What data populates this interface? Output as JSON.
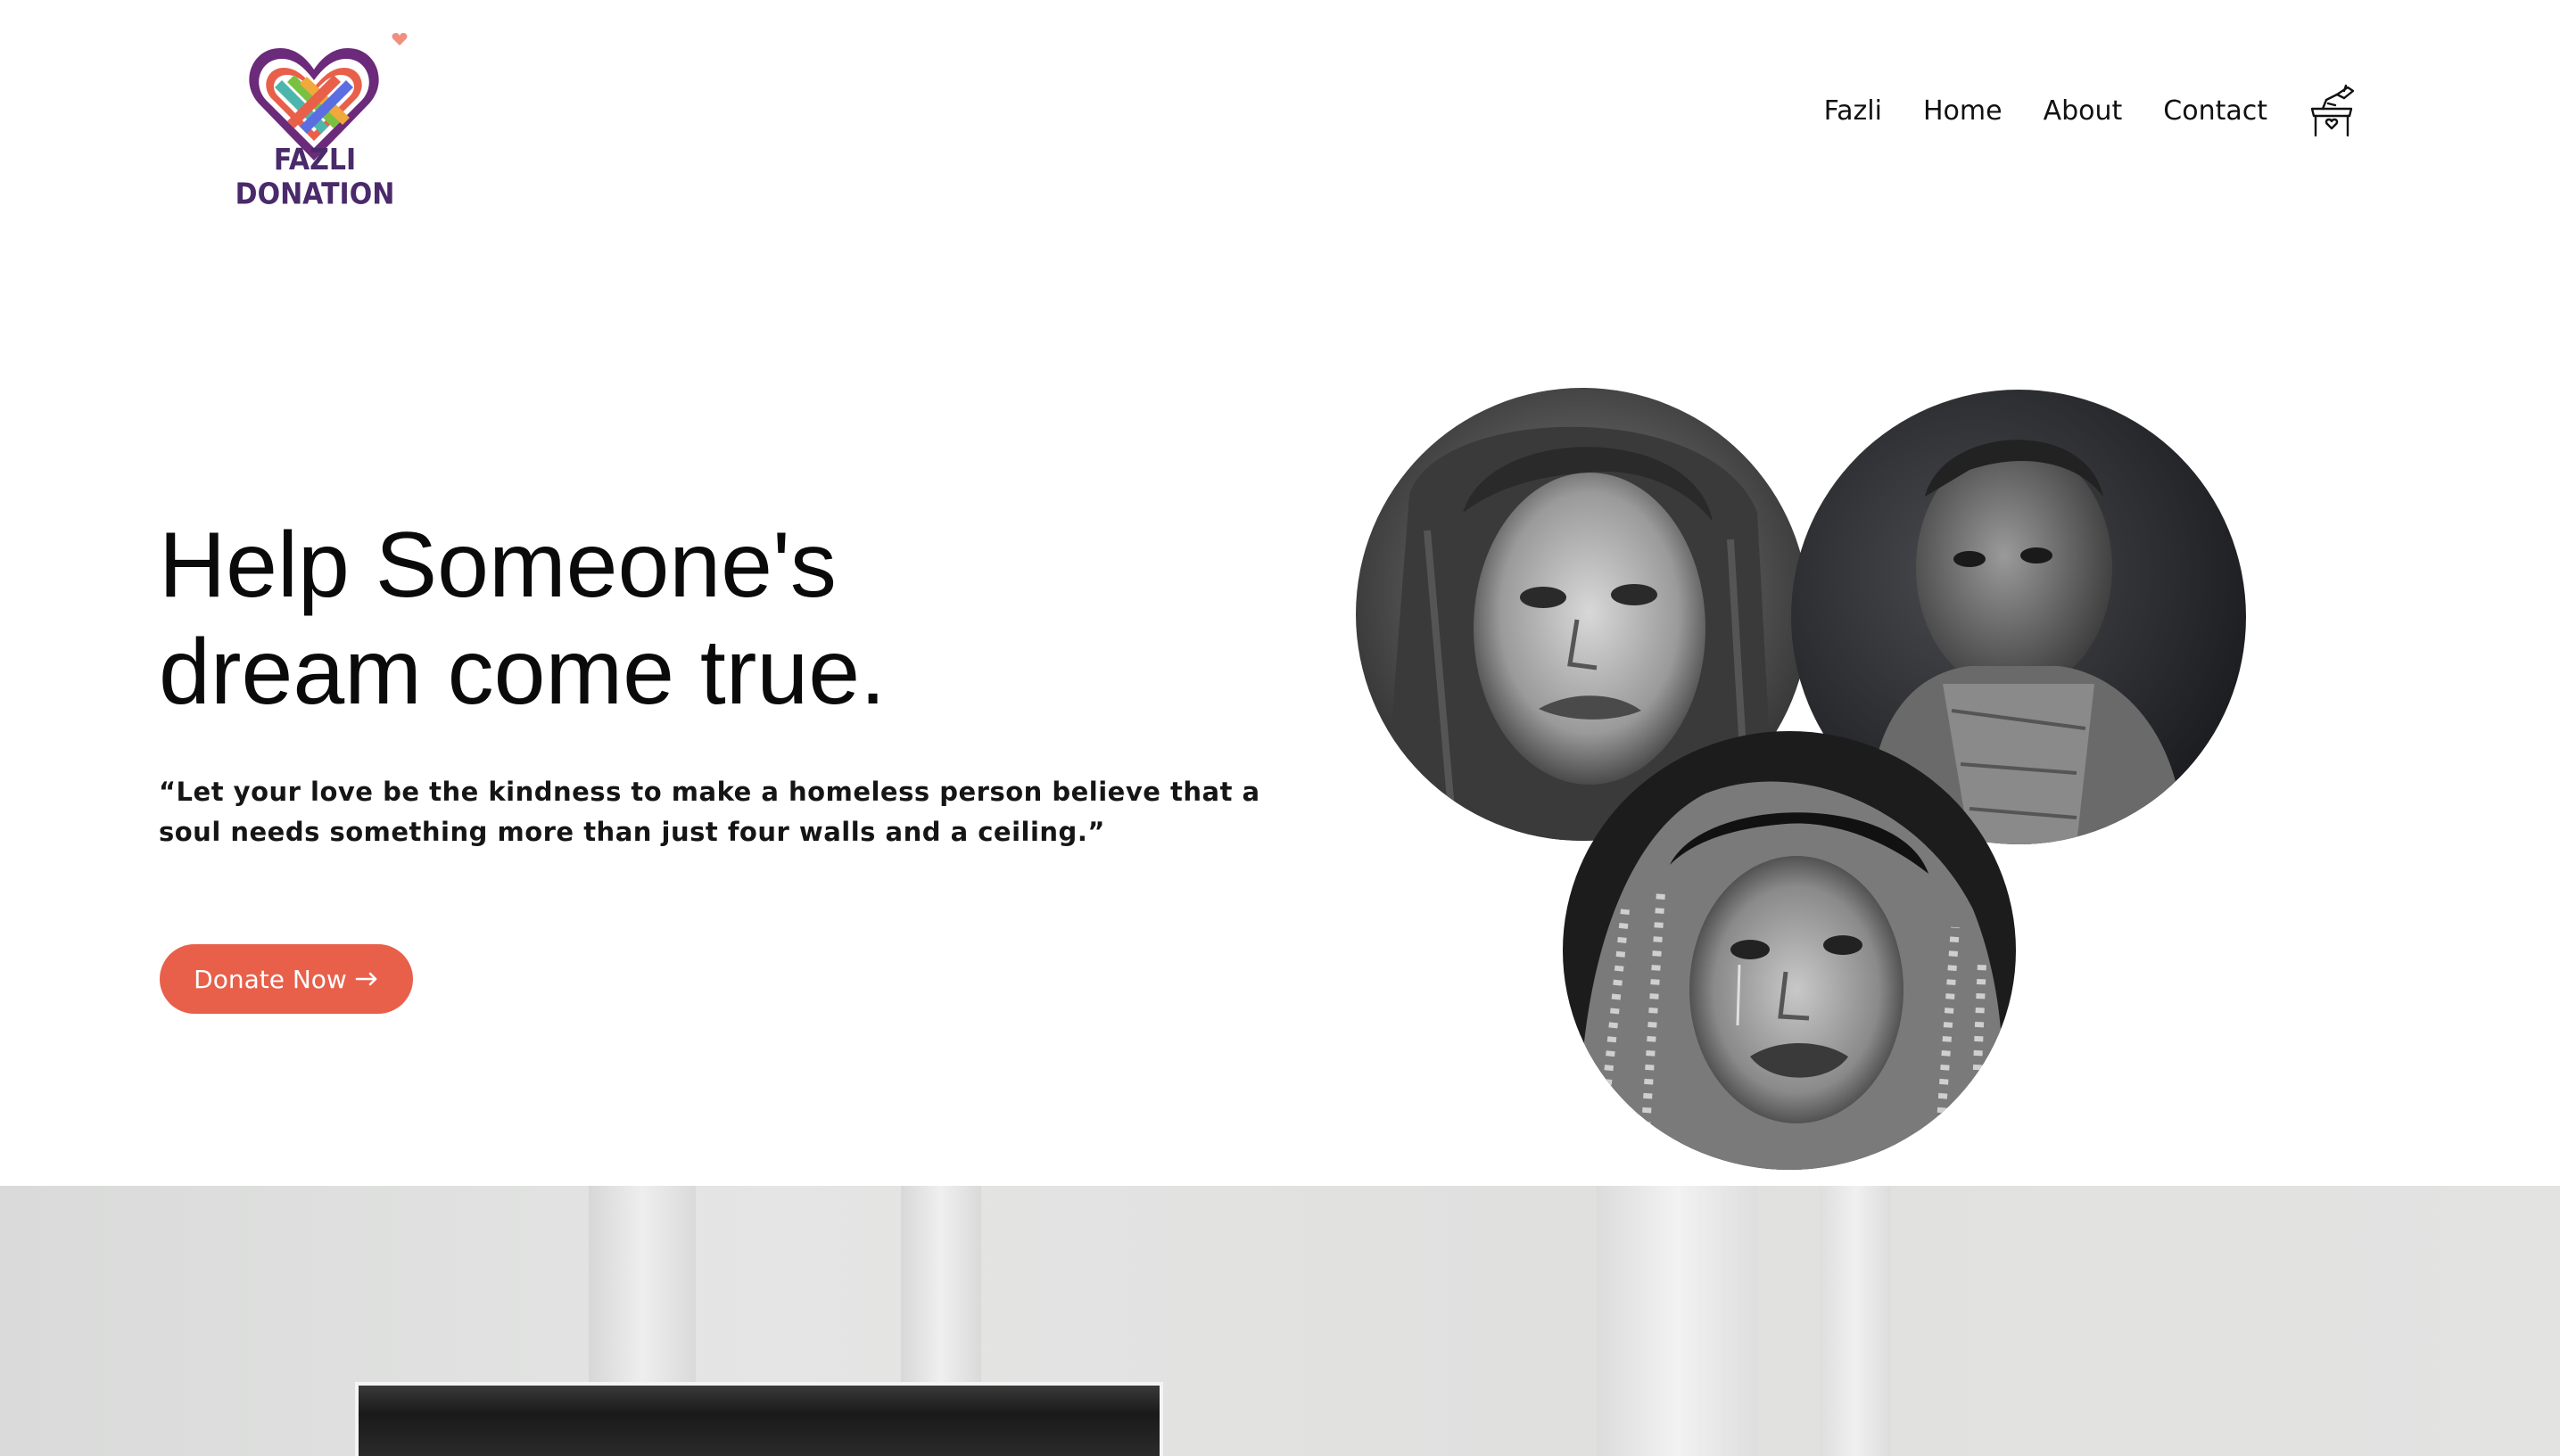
{
  "brand": {
    "name": "FAZLI DONATION",
    "colors": {
      "accent": "#e8604a",
      "logo_text": "#4a2a6b",
      "heart_outer": "#6b2a7a",
      "heart_stripes": [
        "#e8604a",
        "#f2a93b",
        "#4db6ac",
        "#7ac142",
        "#5b6ee1"
      ]
    }
  },
  "nav": {
    "items": [
      {
        "label": "Fazli"
      },
      {
        "label": "Home"
      },
      {
        "label": "About"
      },
      {
        "label": "Contact"
      }
    ],
    "donation_icon": "donation-box-icon"
  },
  "hero": {
    "title_line1": "Help Someone's",
    "title_line2": "dream come true.",
    "quote": "“Let your love be the kindness to make a homeless person believe that a soul needs something more than just four walls and a ceiling.”",
    "cta_label": "Donate Now",
    "cta_icon": "arrow-right-icon"
  },
  "images": [
    {
      "name": "child-portrait-1"
    },
    {
      "name": "child-portrait-2"
    },
    {
      "name": "child-portrait-3"
    }
  ]
}
